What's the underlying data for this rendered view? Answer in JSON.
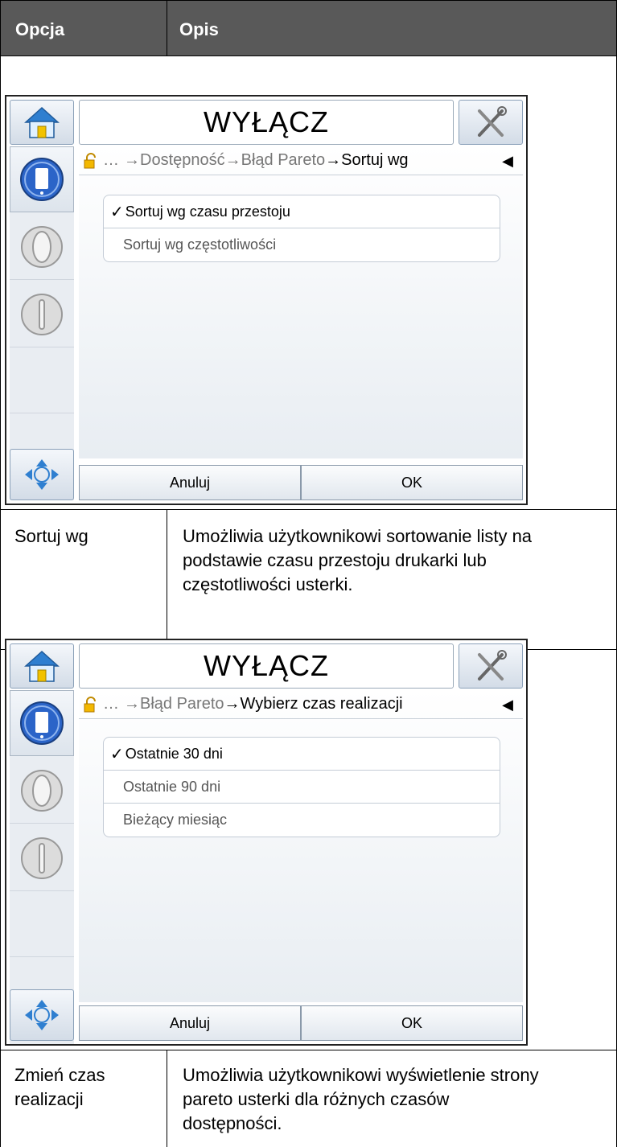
{
  "header": {
    "col1": "Opcja",
    "col2": "Opis"
  },
  "screens": [
    {
      "title": "WYŁĄCZ",
      "breadcrumb": {
        "ellipsis": "…",
        "part1": "→Dostępność→Błąd Pareto",
        "part2": "→Sortuj wg"
      },
      "back": "◀",
      "items": [
        {
          "check": "✓",
          "label": "Sortuj wg czasu przestoju",
          "selected": true
        },
        {
          "check": "",
          "label": "Sortuj wg częstotliwości",
          "selected": false
        }
      ],
      "cancel": "Anuluj",
      "ok": "OK"
    },
    {
      "title": "WYŁĄCZ",
      "breadcrumb": {
        "ellipsis": "…",
        "part1": "→Błąd Pareto",
        "part2": "→Wybierz czas realizacji"
      },
      "back": "◀",
      "items": [
        {
          "check": "✓",
          "label": "Ostatnie 30 dni",
          "selected": true
        },
        {
          "check": "",
          "label": "Ostatnie 90 dni",
          "selected": false
        },
        {
          "check": "",
          "label": "Bieżący miesiąc",
          "selected": false
        }
      ],
      "cancel": "Anuluj",
      "ok": "OK"
    }
  ],
  "rows": [
    {
      "option": "Sortuj wg",
      "description": [
        "Umożliwia użytkownikowi sortowanie listy na",
        "podstawie czasu przestoju drukarki lub",
        "częstotliwości usterki."
      ]
    },
    {
      "option": [
        "Zmień czas",
        "realizacji"
      ],
      "description": [
        "Umożliwia użytkownikowi wyświetlenie strony",
        "pareto usterki dla różnych czasów",
        "dostępności."
      ]
    }
  ],
  "colors": {
    "header_bg": "#595959",
    "header_text": "#ffffff",
    "blue_icon": "#2b64c8"
  }
}
